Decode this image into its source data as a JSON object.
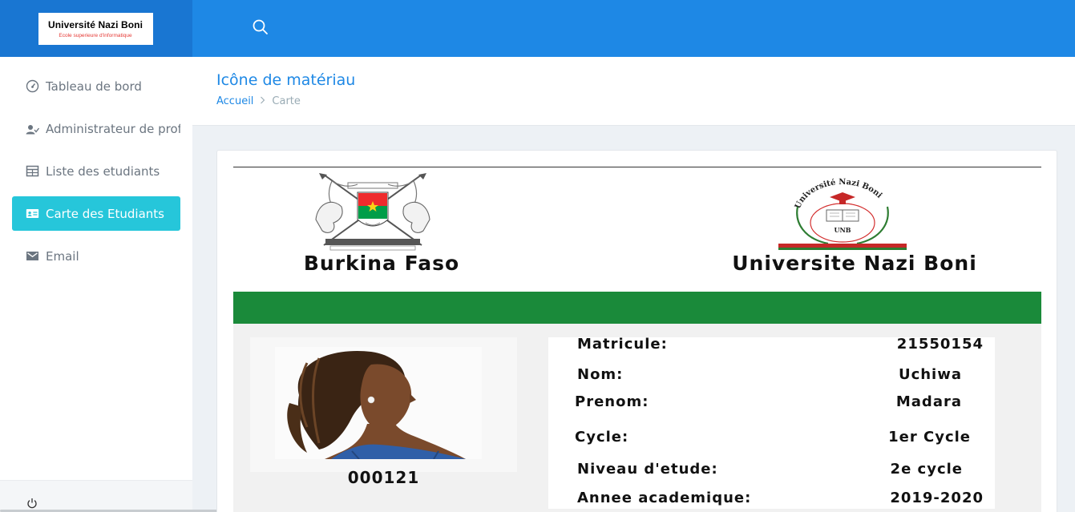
{
  "brand": {
    "title": "Université Nazi Boni",
    "subtitle": "Ecole superieure d'informatique"
  },
  "colors": {
    "topbar": "#1e88e5",
    "brand_bg": "#1976d2",
    "active_nav": "#26c6da",
    "green_band": "#1a8a3a",
    "flag_red": "#ef2b2d",
    "flag_green": "#009e49",
    "flag_star": "#fcd116"
  },
  "search": {
    "icon": "search-icon"
  },
  "sidebar": {
    "items": [
      {
        "label": "Tableau de bord",
        "icon": "gauge-icon",
        "active": false
      },
      {
        "label": "Administrateur de prof",
        "icon": "user-check-icon",
        "active": false
      },
      {
        "label": "Liste des etudiants",
        "icon": "table-icon",
        "active": false
      },
      {
        "label": "Carte des Etudiants",
        "icon": "id-card-icon",
        "active": true
      },
      {
        "label": "Email",
        "icon": "mail-icon",
        "active": false
      }
    ],
    "footer_icon": "power-icon"
  },
  "page": {
    "title": "Icône de matériau",
    "breadcrumb": [
      "Accueil",
      "Carte"
    ]
  },
  "card": {
    "country": "Burkina Faso",
    "university": "Universite Nazi Boni",
    "logo_text": "Université Nazi Boni",
    "logo_abbr": "UNB",
    "student_number": "000121",
    "fields": [
      {
        "label": "Matricule:",
        "value": "21550154"
      },
      {
        "label": "Nom:",
        "value": "Uchiwa"
      },
      {
        "label": "Prenom:",
        "value": "Madara"
      },
      {
        "label": "Cycle:",
        "value": "1er Cycle"
      },
      {
        "label": "Niveau d'etude:",
        "value": "2e cycle"
      },
      {
        "label": "Annee academique:",
        "value": "2019-2020"
      }
    ]
  }
}
